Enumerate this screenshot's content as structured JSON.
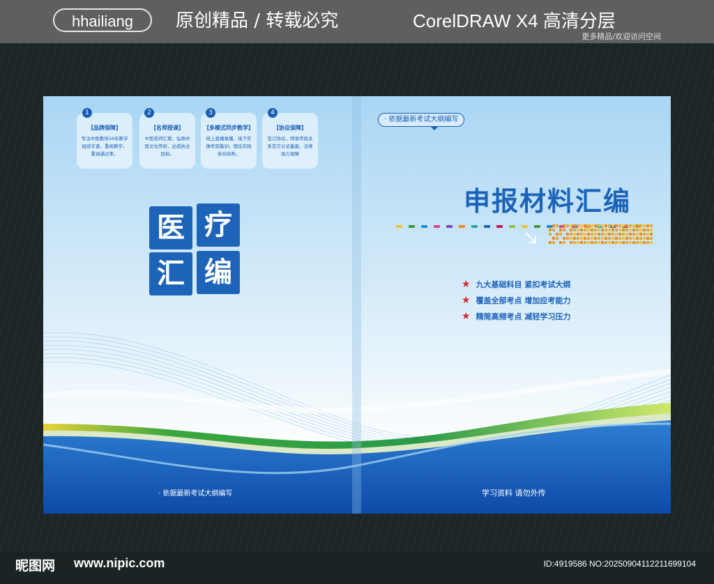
{
  "watermark": {
    "brand": "hhailiang",
    "slogan": "原创精品 / 转载必究",
    "software": "CorelDRAW X4  高清分层",
    "subtitle": "更多精品/欢迎访问空间",
    "site_logo": "昵图网",
    "site_url": "www.nipic.com",
    "image_id": "ID:4919586 NO:20250904112211699104"
  },
  "back_cover": {
    "features": [
      {
        "num": "1",
        "title": "【品牌保障】",
        "desc": "专注中医教培16年教学经验丰富，重视教学，重视通过率。"
      },
      {
        "num": "2",
        "title": "【名师授课】",
        "desc": "中医名师汇聚，弘扬中医文化传统，达成执业目标。"
      },
      {
        "num": "3",
        "title": "【多模式同步教学】",
        "desc": "线上直播录播，线下实操考前集训，理论实践多向培养。"
      },
      {
        "num": "4",
        "title": "【协议保障】",
        "desc": "签订协议，师承传统关系官方公证备案，法律效力保障"
      }
    ],
    "stamp": [
      "医",
      "疗",
      "汇",
      "编"
    ],
    "footer": "· 依据最新考试大纲编写"
  },
  "front_cover": {
    "tag": "· 依据最新考试大纲编写",
    "title": "申报材料汇编",
    "bullets": [
      "九大基础科目 紧扣考试大纲",
      "覆盖全部考点 增加应考能力",
      "精简高频考点 减轻学习压力"
    ],
    "footer": "学习资料 请勿外传"
  },
  "colors": {
    "brand_blue": "#1d64b8",
    "star_red": "#d1272b",
    "dot_palette": [
      "#f2c12e",
      "#3b9a3c",
      "#1a8fd4",
      "#e0468a",
      "#7d4bb5",
      "#f08a1a",
      "#2aa6a0",
      "#1d64b8",
      "#c2185b",
      "#8bc34a"
    ]
  }
}
